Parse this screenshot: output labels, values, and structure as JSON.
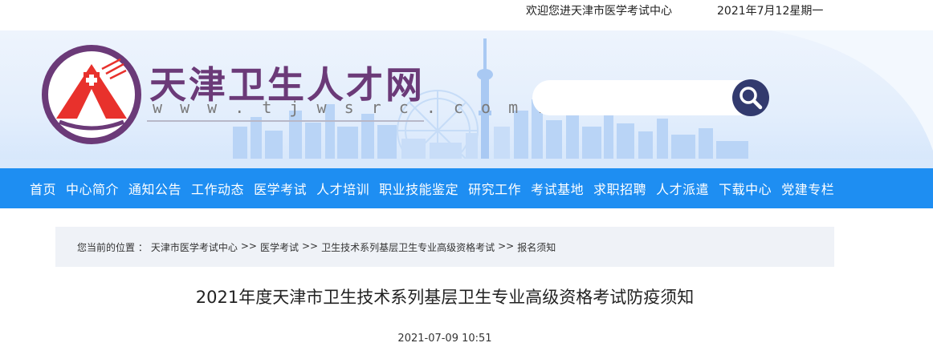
{
  "topbar": {
    "welcome": "欢迎您进天津市医学考试中心",
    "date": "2021年7月12星期一"
  },
  "logo": {
    "title": "天津卫生人才网",
    "url": "w w w . t j w s r c . c o m . c n"
  },
  "search": {
    "placeholder": "",
    "icon": "search-icon"
  },
  "colors": {
    "nav_bg": "#1e8ef2",
    "logo_purple": "#6b3a78",
    "emblem_red": "#e8312c",
    "search_btn": "#323a6e"
  },
  "nav": {
    "items": [
      "首页",
      "中心简介",
      "通知公告",
      "工作动态",
      "医学考试",
      "人才培训",
      "职业技能鉴定",
      "研究工作",
      "考试基地",
      "求职招聘",
      "人才派遣",
      "下载中心",
      "党建专栏"
    ]
  },
  "breadcrumb": {
    "prefix": "您当前的位置 ：",
    "items": [
      "天津市医学考试中心",
      "医学考试",
      "卫生技术系列基层卫生专业高级资格考试",
      "报名须知"
    ],
    "separator": ">>"
  },
  "article": {
    "title": "2021年度天津市卫生技术系列基层卫生专业高级资格考试防疫须知",
    "date": "2021-07-09 10:51"
  }
}
